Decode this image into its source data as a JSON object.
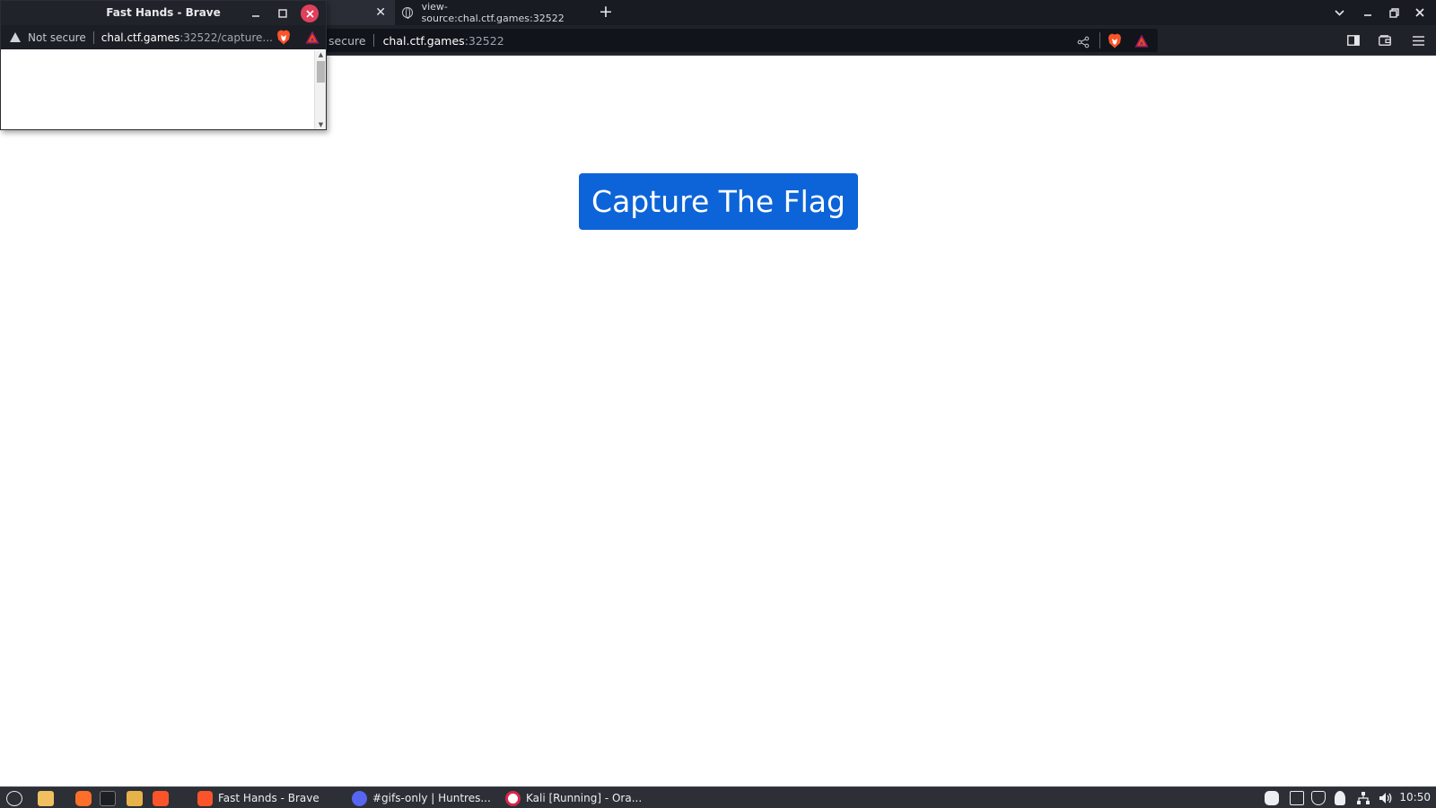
{
  "browser": {
    "tabs": [
      {
        "title": "",
        "active": true
      },
      {
        "title": "view-source:chal.ctf.games:32522",
        "active": false
      }
    ],
    "address": {
      "security_label": "secure",
      "host": "chal.ctf.games",
      "rest": ":32522"
    }
  },
  "popup": {
    "title": "Fast Hands - Brave",
    "address": {
      "security_label": "Not secure",
      "host": "chal.ctf.games",
      "rest": ":32522/capture..."
    }
  },
  "page": {
    "button_label": "Capture The Flag",
    "button_color": "#0d64d8"
  },
  "taskbar": {
    "tasks": [
      {
        "label": "Fast Hands - Brave",
        "icon": "brave-icon"
      },
      {
        "label": "#gifs-only | Huntres...",
        "icon": "discord-icon"
      },
      {
        "label": "Kali [Running] - Ora...",
        "icon": "virtualbox-icon"
      }
    ],
    "clock": "10:50"
  },
  "colors": {
    "brave_orange": "#fb542b",
    "popup_close": "#e0405b",
    "taskbar_bg": "#2c2f35"
  }
}
